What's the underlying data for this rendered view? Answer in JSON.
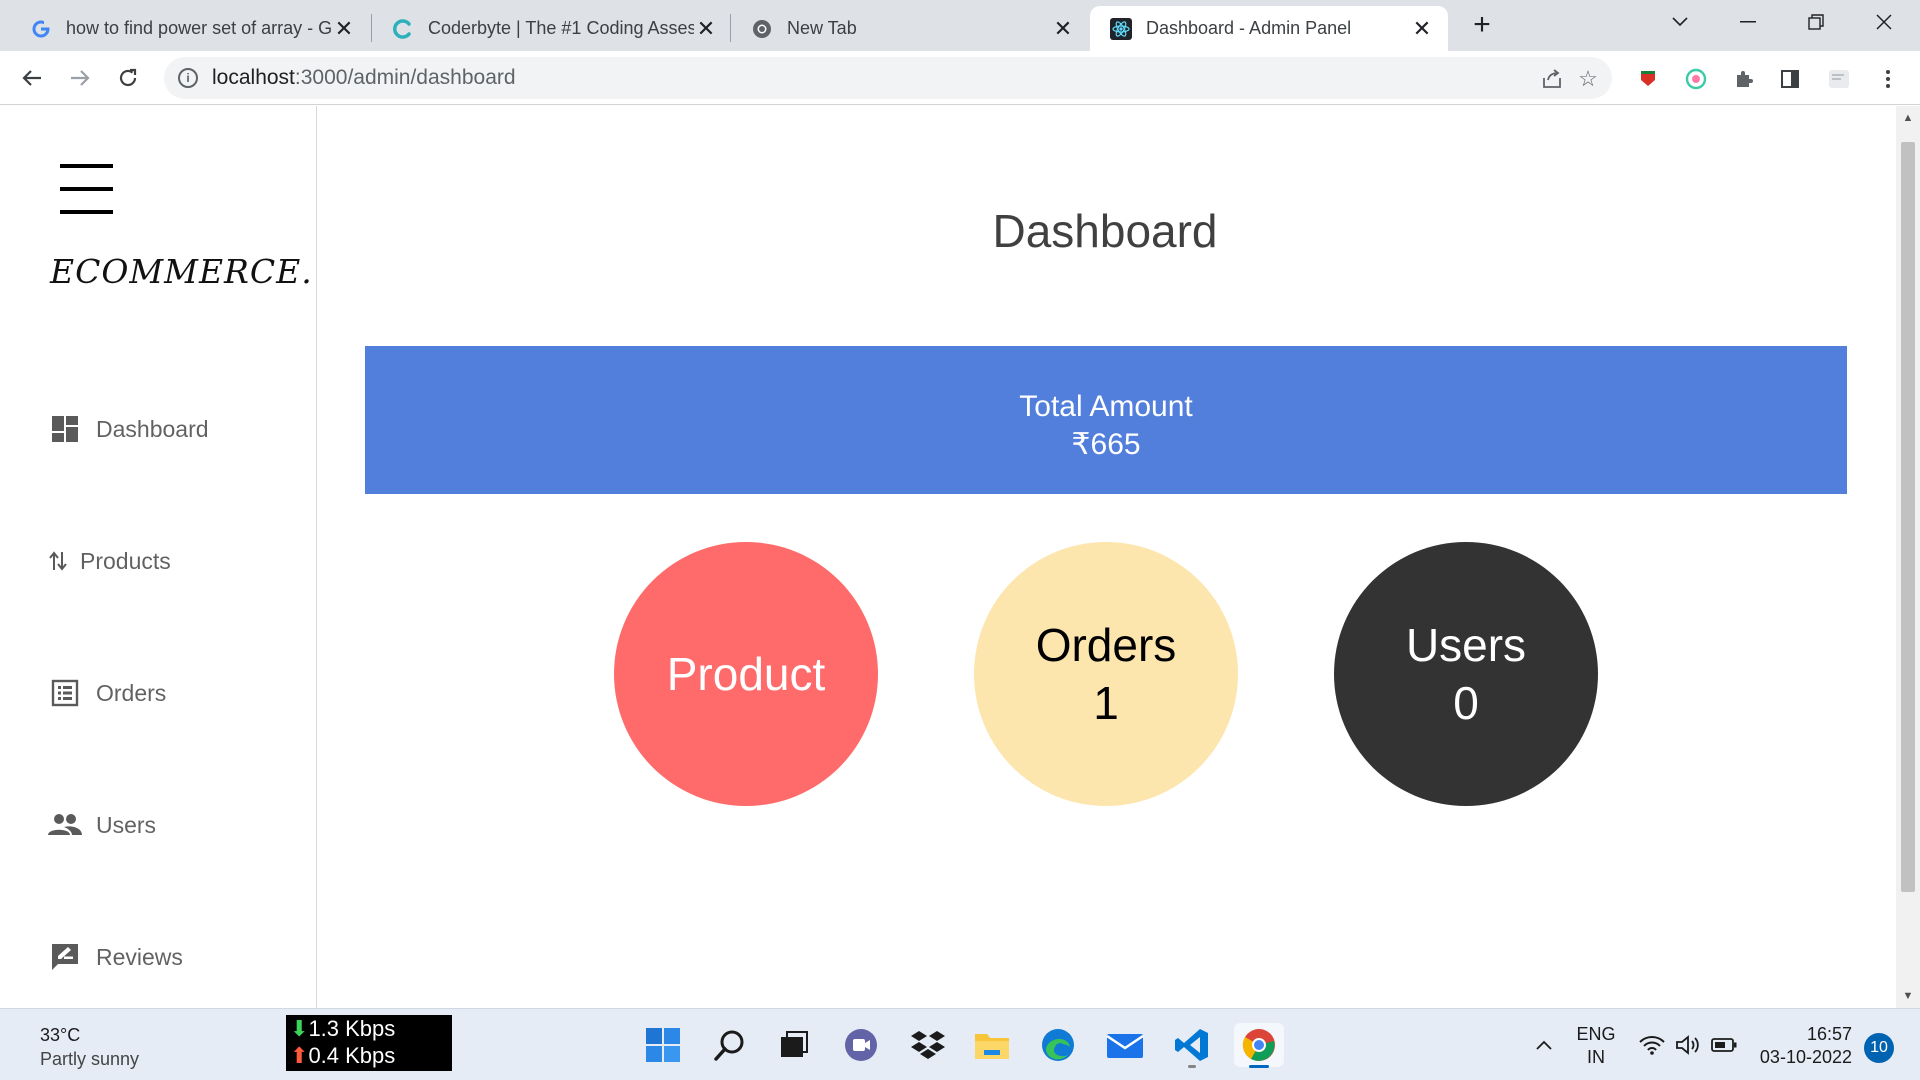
{
  "browser": {
    "tabs": [
      {
        "title": "how to find power set of array - G",
        "icon": "google-icon",
        "active": false
      },
      {
        "title": "Coderbyte | The #1 Coding Asses",
        "icon": "coderbyte-icon",
        "active": false
      },
      {
        "title": "New Tab",
        "icon": "chrome-icon",
        "active": false
      },
      {
        "title": "Dashboard - Admin Panel",
        "icon": "react-icon",
        "active": true
      }
    ],
    "url_host": "localhost",
    "url_path": ":3000/admin/dashboard"
  },
  "sidebar": {
    "logo": "ECOMMERCE.",
    "items": [
      {
        "label": "Dashboard",
        "icon": "dashboard-icon"
      },
      {
        "label": "Products",
        "icon": "import-export-icon"
      },
      {
        "label": "Orders",
        "icon": "list-alt-icon"
      },
      {
        "label": "Users",
        "icon": "people-icon"
      },
      {
        "label": "Reviews",
        "icon": "rate-review-icon"
      }
    ]
  },
  "dashboard": {
    "title": "Dashboard",
    "total_label": "Total Amount",
    "total_value": "₹665",
    "circles": {
      "product": {
        "label": "Product",
        "color": "#ff6b6b"
      },
      "orders": {
        "label": "Orders",
        "value": "1",
        "color": "#fde6ae"
      },
      "users": {
        "label": "Users",
        "value": "0",
        "color": "#333333"
      }
    },
    "accent_color": "#527fdc"
  },
  "taskbar": {
    "temperature": "33°C",
    "condition": "Partly sunny",
    "download": "1.3 Kbps",
    "upload": "0.4 Kbps",
    "lang_top": "ENG",
    "lang_bottom": "IN",
    "time": "16:57",
    "date": "03-10-2022",
    "notifications": "10"
  }
}
